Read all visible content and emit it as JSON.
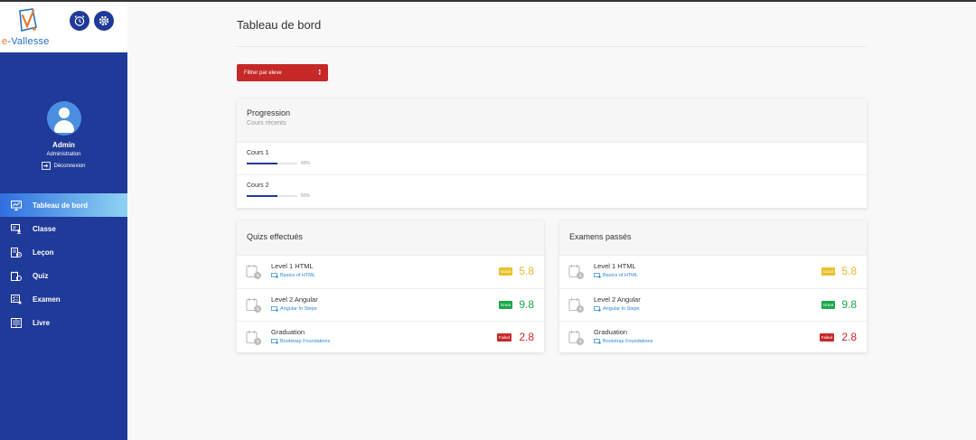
{
  "brand": {
    "logo_text_e": "e",
    "logo_text_rest": "-Vallesse"
  },
  "profile": {
    "name": "Admin",
    "role": "Administration",
    "logout_label": "Déconnexion"
  },
  "nav": [
    {
      "label": "Tableau de bord",
      "icon": "dashboard-icon",
      "active": true
    },
    {
      "label": "Classe",
      "icon": "classroom-icon"
    },
    {
      "label": "Leçon",
      "icon": "lesson-icon"
    },
    {
      "label": "Quiz",
      "icon": "quiz-icon"
    },
    {
      "label": "Examen",
      "icon": "exam-icon"
    },
    {
      "label": "Livre",
      "icon": "book-icon"
    }
  ],
  "header": {
    "title": "Tableau de bord",
    "filter_label": "Filtrer par eleve",
    "caret": "▲\n▼"
  },
  "progress": {
    "title": "Progression",
    "subtitle": "Cours récents",
    "courses": [
      {
        "name": "Cours 1",
        "percent": 60,
        "percent_label": "60%"
      },
      {
        "name": "Cours 2",
        "percent": 60,
        "percent_label": "60%"
      }
    ]
  },
  "quizzes": {
    "title": "Quizs effectués",
    "items": [
      {
        "title": "Level 1 HTML",
        "course": "Basics of HTML",
        "badge": "Good",
        "score": "5.8",
        "status": "good"
      },
      {
        "title": "Level 2 Angular",
        "course": "Angular In Steps",
        "badge": "Great",
        "score": "9.8",
        "status": "great"
      },
      {
        "title": "Graduation",
        "course": "Bootstrap Foundations",
        "badge": "Failed",
        "score": "2.8",
        "status": "failed"
      }
    ]
  },
  "exams": {
    "title": "Examens passés",
    "items": [
      {
        "title": "Level 1 HTML",
        "course": "Basics of HTML",
        "badge": "Good",
        "score": "5.8",
        "status": "good"
      },
      {
        "title": "Level 2 Angular",
        "course": "Angular In Steps",
        "badge": "Great",
        "score": "9.8",
        "status": "great"
      },
      {
        "title": "Graduation",
        "course": "Bootstrap Foundations",
        "badge": "Failed",
        "score": "2.8",
        "status": "failed"
      }
    ]
  },
  "colors": {
    "sidebar": "#1f3a98",
    "good_badge": "#e8c12a",
    "good_score": "#e6b83a",
    "great_badge": "#1aa84a",
    "great_score": "#1aa84a",
    "failed_badge": "#c62828",
    "failed_score": "#c62828",
    "progress_fill": "#1f3a98",
    "filter_button": "#c62828"
  }
}
